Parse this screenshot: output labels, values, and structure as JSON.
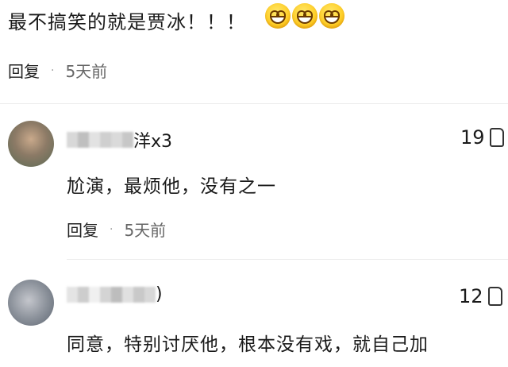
{
  "top_comment": {
    "text": "最不搞笑的就是贾冰！！！",
    "emoji_icon": "grinning-face-icon"
  },
  "top_meta": {
    "reply": "回复",
    "dot": "·",
    "time": "5天前"
  },
  "comments": [
    {
      "username_suffix": "洋x3",
      "text": "尬演，最烦他，没有之一",
      "likes": "19",
      "reply": "回复",
      "dot": "·",
      "time": "5天前"
    },
    {
      "username_suffix": ")",
      "text": "同意，特别讨厌他，根本没有戏，就自己加",
      "likes": "12"
    }
  ],
  "colors": {
    "divider": "#ececec",
    "emoji": "#ffd02a"
  }
}
